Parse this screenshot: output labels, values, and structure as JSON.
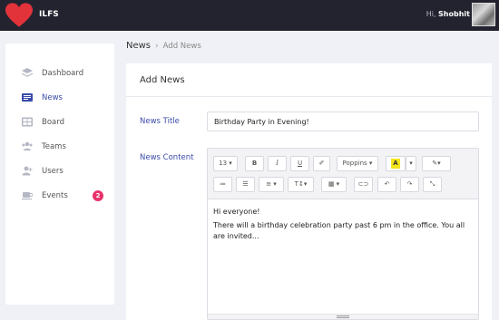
{
  "header": {
    "app_name": "ILFS",
    "greeting": "Hi,",
    "user_name": "Shobhit",
    "logo_icon": "heart-icon",
    "logo_color": "#e2323a"
  },
  "sidebar": {
    "items": [
      {
        "label": "Dashboard",
        "icon": "layers-icon"
      },
      {
        "label": "News",
        "icon": "news-icon",
        "active": true
      },
      {
        "label": "Board",
        "icon": "board-icon"
      },
      {
        "label": "Teams",
        "icon": "teams-icon"
      },
      {
        "label": "Users",
        "icon": "user-add-icon"
      },
      {
        "label": "Events",
        "icon": "coffee-icon",
        "badge": "2"
      }
    ],
    "accent_color": "#3b4ba8",
    "badge_color": "#e8336b"
  },
  "breadcrumb": {
    "section": "News",
    "separator": "›",
    "current": "Add News"
  },
  "form": {
    "card_title": "Add News",
    "title_label": "News Title",
    "title_value": "Birthday Party in Evening!",
    "content_label": "News Content",
    "editor": {
      "toolbar": {
        "font_size": "13 ▾",
        "bold": "B",
        "italic": "I",
        "underline": "U",
        "clear": "✐",
        "font_family": "Poppins ▾",
        "highlight": "A",
        "color_dropdown": "▾",
        "magic": "✎▾",
        "ordered_list": "≔",
        "unordered_list": "☰",
        "align": "≡ ▾",
        "text_size": "T↕▾",
        "table": "▦ ▾",
        "link": "⊂⊃",
        "undo": "↶",
        "redo": "↷",
        "fullscreen": "⤡"
      },
      "content": [
        "Hi everyone!",
        "There will a birthday celebration party past 6 pm in the office. You all are invited..."
      ]
    }
  }
}
